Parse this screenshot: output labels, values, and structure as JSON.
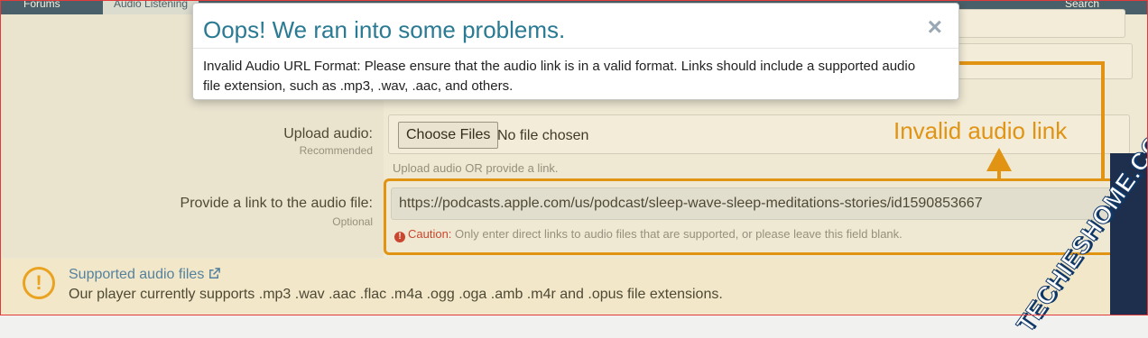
{
  "nav": {
    "tabs": [
      {
        "label": "Forums",
        "active": false
      },
      {
        "label": "Audio Listening",
        "active": true
      },
      {
        "label": "Search",
        "active": false
      }
    ]
  },
  "form": {
    "upload": {
      "label": "Upload audio:",
      "sublabel": "Recommended",
      "button_label": "Choose Files",
      "file_status": "No file chosen",
      "hint": "Upload audio OR provide a link."
    },
    "link": {
      "label": "Provide a link to the audio file:",
      "sublabel": "Optional",
      "value": "https://podcasts.apple.com/us/podcast/sleep-wave-sleep-meditations-stories/id1590853667",
      "caution_label": "Caution:",
      "caution_text": "Only enter direct links to audio files that are supported, or please leave this field blank."
    }
  },
  "notice": {
    "title": "Supported audio files",
    "text": "Our player currently supports .mp3 .wav .aac .flac .m4a .ogg .oga .amb .m4r and .opus file extensions."
  },
  "modal": {
    "title": "Oops! We ran into some problems.",
    "close": "×",
    "message": "Invalid Audio URL Format: Please ensure that the audio link is in a valid format. Links should include a supported audio file extension, such as .mp3, .wav, .aac, and others."
  },
  "annotation": {
    "label": "Invalid audio link"
  },
  "watermark": {
    "text": "TECHIESHOME.COM"
  },
  "colors": {
    "accent_orange": "#e19413",
    "modal_title": "#2a7a93",
    "caution_red": "#c9302c",
    "nav_bg": "#2c4f73"
  }
}
